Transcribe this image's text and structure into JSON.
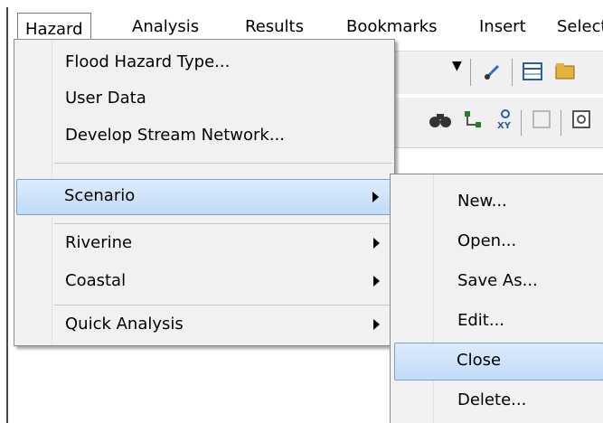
{
  "menubar": {
    "items": [
      "Hazard",
      "Analysis",
      "Results",
      "Bookmarks",
      "Insert",
      "Selecti"
    ]
  },
  "main_menu": {
    "items": [
      {
        "label": "Flood Hazard Type...",
        "submenu": false
      },
      {
        "label": "User Data",
        "submenu": false
      },
      {
        "label": "Develop Stream Network...",
        "submenu": false
      },
      {
        "label": "Scenario",
        "submenu": true,
        "highlighted": true
      },
      {
        "label": "Riverine",
        "submenu": true
      },
      {
        "label": "Coastal",
        "submenu": true
      },
      {
        "label": "Quick Analysis",
        "submenu": true
      }
    ]
  },
  "scenario_submenu": {
    "items": [
      {
        "label": "New..."
      },
      {
        "label": "Open..."
      },
      {
        "label": "Save As..."
      },
      {
        "label": "Edit..."
      },
      {
        "label": "Close",
        "highlighted": true
      },
      {
        "label": "Delete..."
      }
    ]
  },
  "toolbar": {
    "icons": [
      "pen-icon",
      "table-icon",
      "folder-icon",
      "binoculars-icon",
      "network-icon",
      "xy-icon",
      "blank-icon",
      "zoom-icon"
    ]
  },
  "colors": {
    "highlight_fill": "#c1dbfa",
    "highlight_border": "#7da2ce",
    "menu_bg": "#f1f1f1"
  }
}
